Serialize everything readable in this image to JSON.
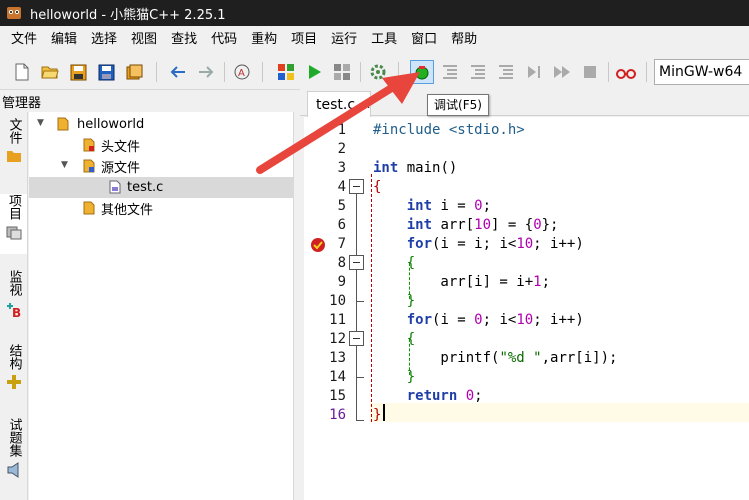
{
  "window": {
    "title": "helloworld - 小熊猫C++ 2.25.1"
  },
  "menu": [
    "文件",
    "编辑",
    "选择",
    "视图",
    "查找",
    "代码",
    "重构",
    "项目",
    "运行",
    "工具",
    "窗口",
    "帮助"
  ],
  "toolbar": {
    "compiler": "MinGW-w64",
    "tooltip": "调试(F5)"
  },
  "manager": {
    "title": "管理器"
  },
  "side_tabs": [
    "文件",
    "项目",
    "监视",
    "结构",
    "试题集"
  ],
  "tree": {
    "project": "helloworld",
    "headers": "头文件",
    "sources": "源文件",
    "file": "test.c",
    "others": "其他文件"
  },
  "editor": {
    "tab": "test.c",
    "tab_close": "✕",
    "line_numbers": [
      "1",
      "2",
      "3",
      "4",
      "5",
      "6",
      "7",
      "8",
      "9",
      "10",
      "11",
      "12",
      "13",
      "14",
      "15",
      "16"
    ],
    "lines": [
      "#include <stdio.h>",
      "",
      "int main()",
      "{",
      "    int i = 0;",
      "    int arr[10] = {0};",
      "    for(i = i; i<10; i++)",
      "    {",
      "        arr[i] = i+1;",
      "    }",
      "    for(i = 0; i<10; i++)",
      "    {",
      "        printf(\"%d \",arr[i]);",
      "    }",
      "    return 0;",
      "}"
    ]
  },
  "colors": {
    "arrow": "#e8453c",
    "keyword": "#1f3fa8",
    "number": "#b000b0",
    "string": "#0a6b00"
  }
}
